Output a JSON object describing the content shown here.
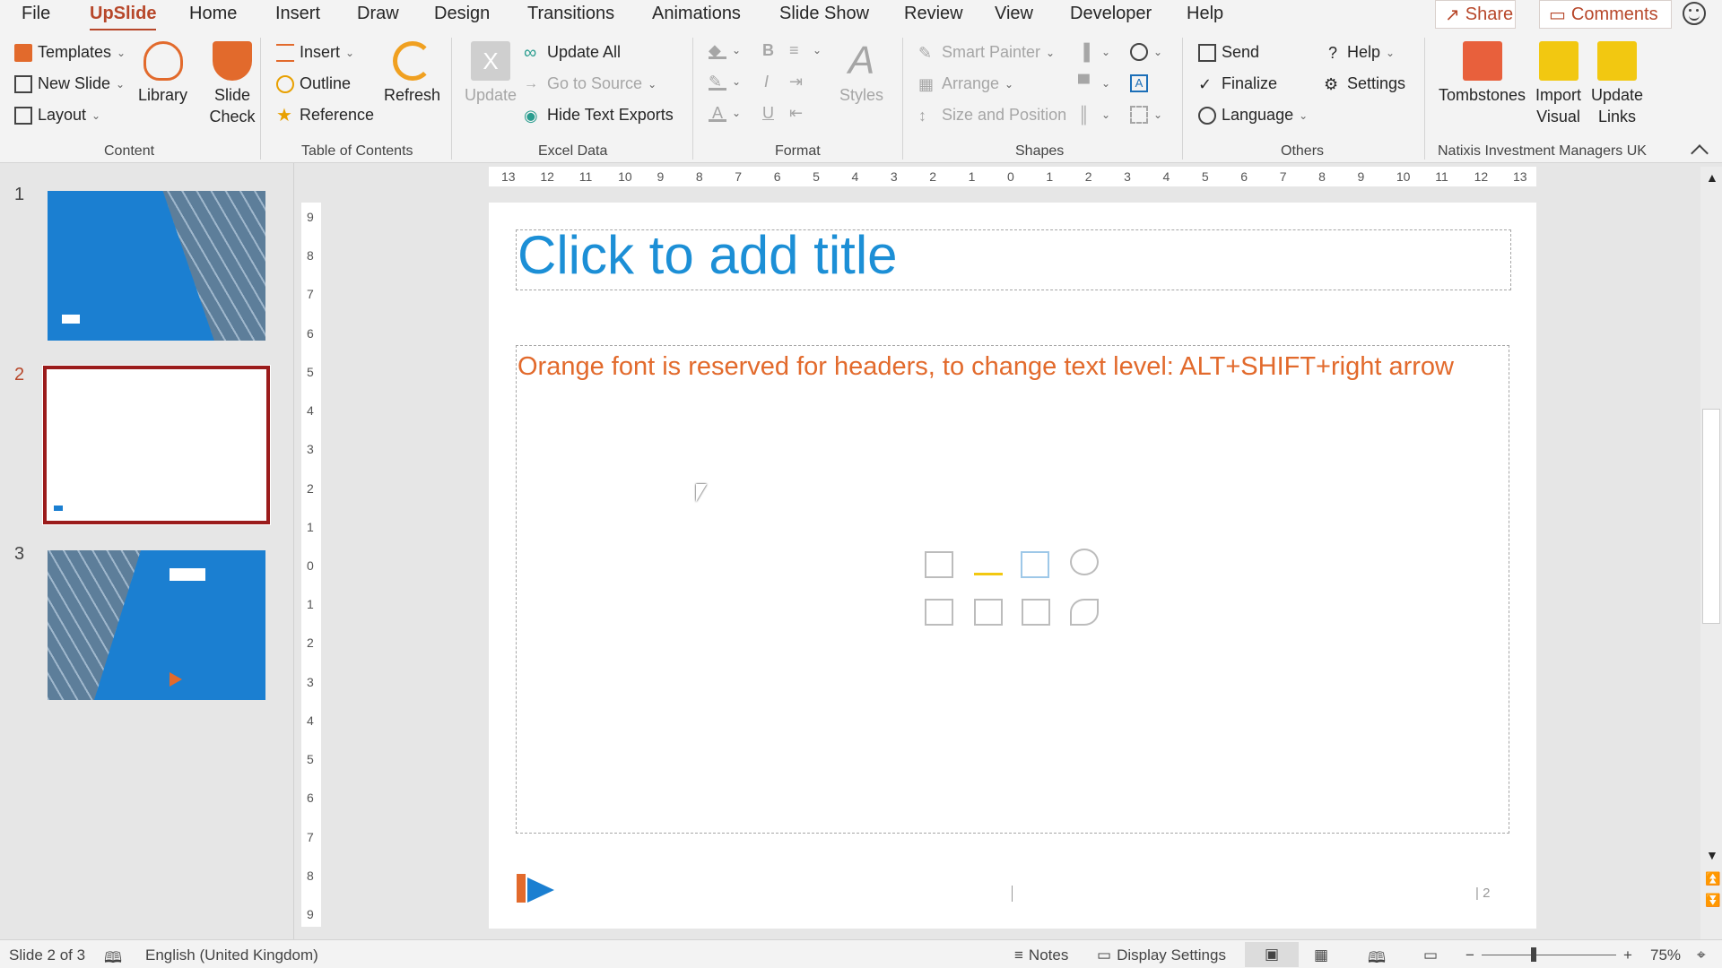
{
  "menu": {
    "tabs": [
      "File",
      "UpSlide",
      "Home",
      "Insert",
      "Draw",
      "Design",
      "Transitions",
      "Animations",
      "Slide Show",
      "Review",
      "View",
      "Developer",
      "Help"
    ],
    "active_tab": "UpSlide",
    "share_label": "Share",
    "comments_label": "Comments"
  },
  "ribbon": {
    "content": {
      "templates": "Templates",
      "new_slide": "New Slide",
      "layout": "Layout",
      "library": "Library",
      "slide_check": "Slide Check",
      "group_label": "Content"
    },
    "toc": {
      "insert": "Insert",
      "outline": "Outline",
      "reference": "Reference",
      "refresh": "Refresh",
      "group_label": "Table of Contents"
    },
    "excel": {
      "update": "Update",
      "update_all": "Update All",
      "go_to_source": "Go to Source",
      "hide_text_exports": "Hide Text Exports",
      "group_label": "Excel Data"
    },
    "format": {
      "bold": "B",
      "italic": "I",
      "underline": "U",
      "styles": "Styles",
      "group_label": "Format"
    },
    "shapes": {
      "smart_painter": "Smart Painter",
      "arrange": "Arrange",
      "size_position": "Size and Position",
      "group_label": "Shapes"
    },
    "others": {
      "send": "Send",
      "finalize": "Finalize",
      "language": "Language",
      "help": "Help",
      "settings": "Settings",
      "group_label": "Others"
    },
    "natixis": {
      "tombstones": "Tombstones",
      "import_visual_1": "Import",
      "import_visual_2": "Visual",
      "update_links_1": "Update",
      "update_links_2": "Links",
      "group_label": "Natixis Investment Managers UK"
    }
  },
  "thumbnails": [
    {
      "number": "1"
    },
    {
      "number": "2"
    },
    {
      "number": "3"
    }
  ],
  "ruler": {
    "horizontal": [
      "13",
      "12",
      "11",
      "10",
      "9",
      "8",
      "7",
      "6",
      "5",
      "4",
      "3",
      "2",
      "1",
      "0",
      "1",
      "2",
      "3",
      "4",
      "5",
      "6",
      "7",
      "8",
      "9",
      "10",
      "11",
      "12",
      "13"
    ],
    "vertical": [
      "9",
      "8",
      "7",
      "6",
      "5",
      "4",
      "3",
      "2",
      "1",
      "0",
      "1",
      "2",
      "3",
      "4",
      "5",
      "6",
      "7",
      "8",
      "9"
    ]
  },
  "slide": {
    "title_placeholder": "Click to add title",
    "body_text": "Orange font is reserved for headers, to change text level: ALT+SHIFT+right arrow",
    "slide_number": "| 2"
  },
  "status": {
    "slide_info": "Slide 2 of 3",
    "language": "English (United Kingdom)",
    "notes": "Notes",
    "display_settings": "Display Settings",
    "zoom": "75%"
  },
  "colors": {
    "accent": "#b7472a",
    "title_blue": "#1c8fd6",
    "body_orange": "#e26a2c",
    "thumb_blue": "#1b7fd1"
  }
}
